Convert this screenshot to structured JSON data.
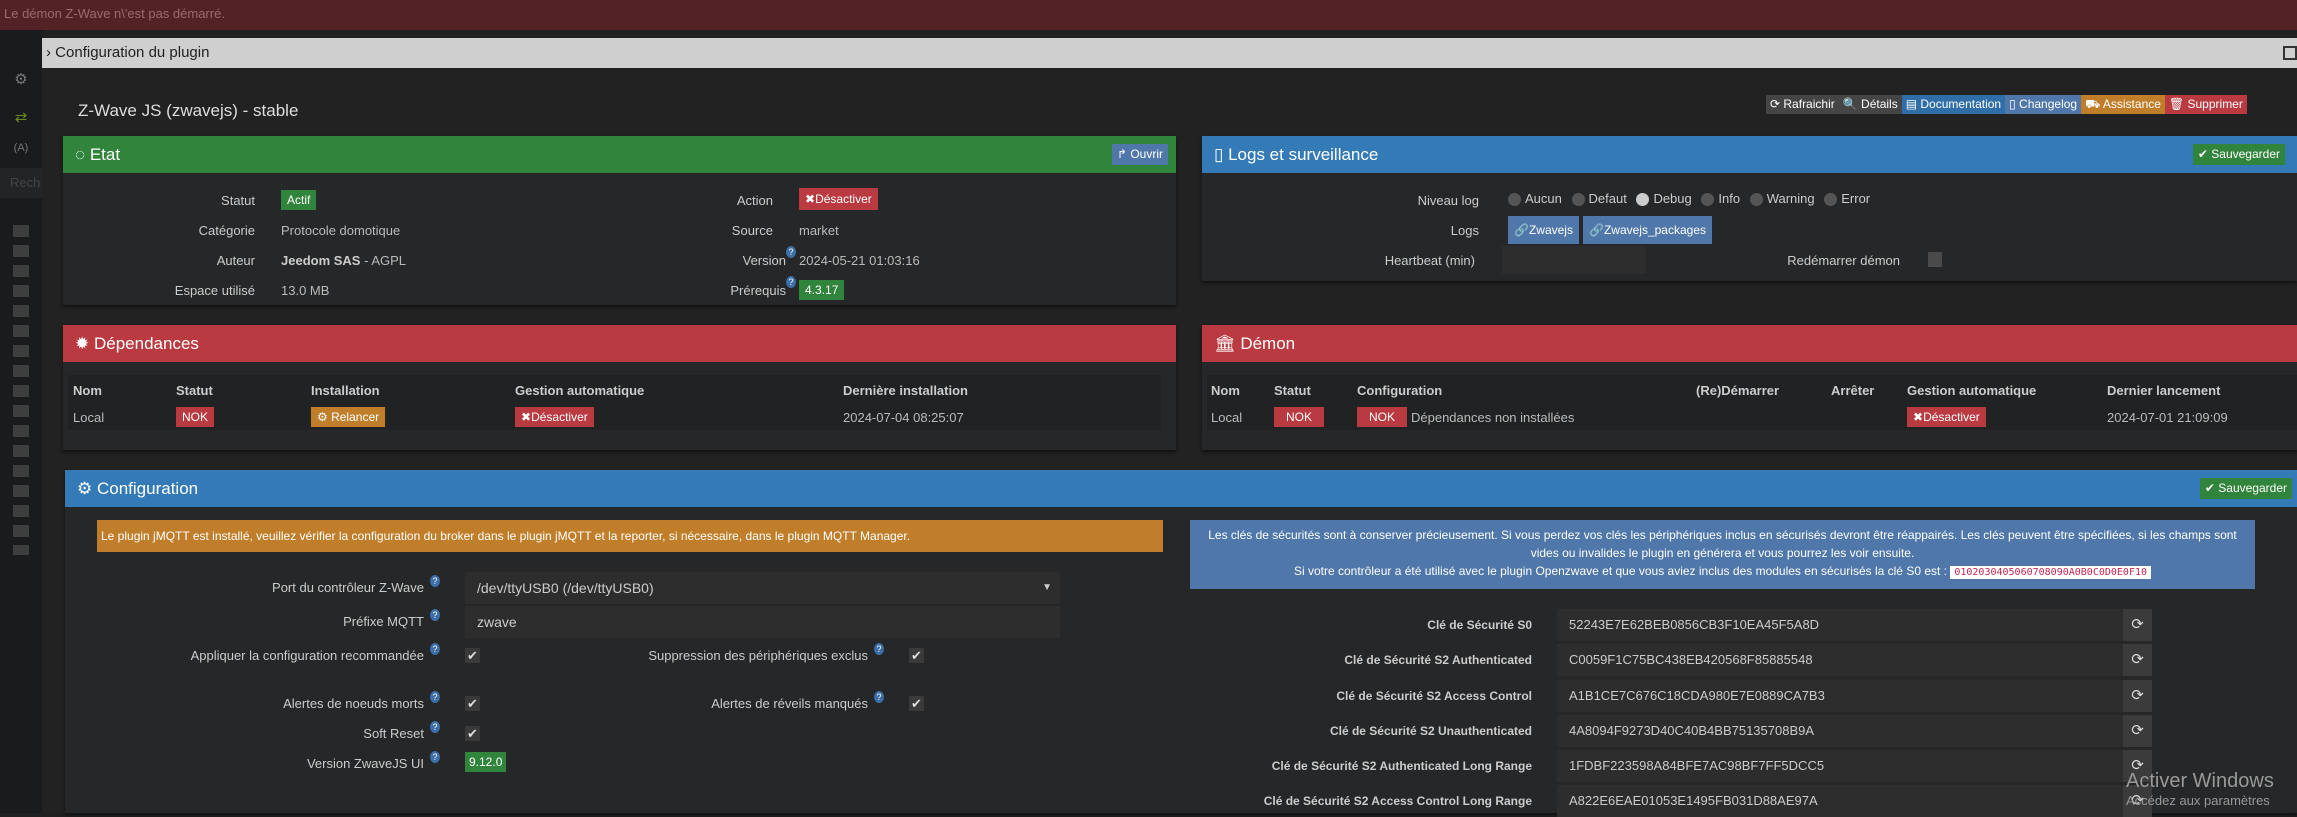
{
  "banner": "Le démon Z-Wave n\\'est pas démarré.",
  "modal": {
    "title": "Configuration du plugin",
    "corner": "D"
  },
  "sidebar": {
    "search_placeholder": "Rech",
    "items": [
      "gear-icon",
      "sync-icon",
      "antenna-icon",
      "device",
      "device",
      "device",
      "device",
      "device",
      "device",
      "device",
      "device",
      "zwave-icon",
      "device",
      "device",
      "device",
      "device",
      "shield-device"
    ]
  },
  "plugin_title": "Z-Wave JS (zwavejs) - stable",
  "toolbar": {
    "refresh": "Rafraichir",
    "details": "Détails",
    "documentation": "Documentation",
    "changelog": "Changelog",
    "assistance": "Assistance",
    "delete": "Supprimer"
  },
  "etat": {
    "title": "Etat",
    "open": "Ouvrir",
    "statut_label": "Statut",
    "statut": "Actif",
    "categorie_label": "Catégorie",
    "categorie": "Protocole domotique",
    "auteur_label": "Auteur",
    "auteur": "Jeedom SAS",
    "licence": "- AGPL",
    "espace_label": "Espace utilisé",
    "espace": "13.0 MB",
    "action_label": "Action",
    "action": "Désactiver",
    "source_label": "Source",
    "source": "market",
    "version_label": "Version",
    "version": "2024-05-21 01:03:16",
    "prerequis_label": "Prérequis",
    "prerequis": "4.3.17"
  },
  "logs": {
    "title": "Logs et surveillance",
    "save": "Sauvegarder",
    "niveau_label": "Niveau log",
    "levels": [
      "Aucun",
      "Defaut",
      "Debug",
      "Info",
      "Warning",
      "Error"
    ],
    "selected": "Debug",
    "logs_label": "Logs",
    "log_buttons": [
      "Zwavejs",
      "Zwavejs_packages"
    ],
    "heartbeat_label": "Heartbeat (min)",
    "heartbeat": "",
    "restart_label": "Redémarrer démon"
  },
  "deps": {
    "title": "Dépendances",
    "headers": [
      "Nom",
      "Statut",
      "Installation",
      "Gestion automatique",
      "Dernière installation"
    ],
    "row": {
      "nom": "Local",
      "statut": "NOK",
      "install": "Relancer",
      "gestion": "Désactiver",
      "date": "2024-07-04 08:25:07"
    }
  },
  "daemon": {
    "title": "Démon",
    "headers": [
      "Nom",
      "Statut",
      "Configuration",
      "(Re)Démarrer",
      "Arrêter",
      "Gestion automatique",
      "Dernier lancement"
    ],
    "row": {
      "nom": "Local",
      "statut": "NOK",
      "config_status": "NOK",
      "config_text": "Dépendances non installées",
      "gestion": "Désactiver",
      "date": "2024-07-01 21:09:09"
    }
  },
  "config": {
    "title": "Configuration",
    "save": "Sauvegarder",
    "mqtt_warning": "Le plugin jMQTT est installé, veuillez vérifier la configuration du broker dans le plugin jMQTT et la reporter, si nécessaire, dans le plugin MQTT Manager.",
    "keys_info_1": "Les clés de sécurités sont à conserver précieusement. Si vous perdez vos clés les périphériques inclus en sécurisés devront être réappairés. Les clés peuvent être spécifiées, si les champs sont vides ou invalides le plugin en générera et vous pourrez les voir ensuite.",
    "keys_info_2": "Si votre contrôleur a été utilisé avec le plugin Openzwave et que vous aviez inclus des modules en sécurisés la clé S0 est :",
    "s0_legacy": "0102030405060708090A0B0C0D0E0F10",
    "port_label": "Port du contrôleur Z-Wave",
    "port": "/dev/ttyUSB0 (/dev/ttyUSB0)",
    "prefix_label": "Préfixe MQTT",
    "prefix": "zwave",
    "apply_label": "Appliquer la configuration recommandée",
    "apply": true,
    "remove_label": "Suppression des périphériques exclus",
    "remove": true,
    "dead_label": "Alertes de noeuds morts",
    "dead": true,
    "wake_label": "Alertes de réveils manqués",
    "wake": true,
    "soft_label": "Soft Reset",
    "soft": true,
    "ui_label": "Version ZwaveJS UI",
    "ui_version": "9.12.0",
    "keys": [
      {
        "label": "Clé de Sécurité S0",
        "value": "52243E7E62BEB0856CB3F10EA45F5A8D"
      },
      {
        "label": "Clé de Sécurité S2 Authenticated",
        "value": "C0059F1C75BC438EB420568F85885548"
      },
      {
        "label": "Clé de Sécurité S2 Access Control",
        "value": "A1B1CE7C676C18CDA980E7E0889CA7B3"
      },
      {
        "label": "Clé de Sécurité S2 Unauthenticated",
        "value": "4A8094F9273D40C40B4BB75135708B9A"
      },
      {
        "label": "Clé de Sécurité S2 Authenticated Long Range",
        "value": "1FDBF223598A84BFE7AC98BF7FF5DCC5"
      },
      {
        "label": "Clé de Sécurité S2 Access Control Long Range",
        "value": "A822E6EAE01053E1495FB031D88AE97A"
      }
    ]
  },
  "watermark": {
    "title": "Activer Windows",
    "sub": "Accédez aux paramètres"
  }
}
